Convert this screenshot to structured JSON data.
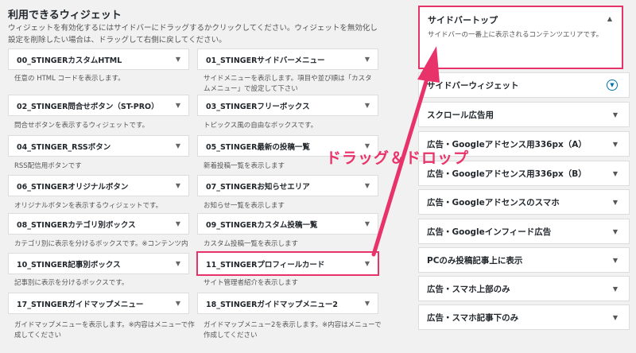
{
  "header": {
    "title": "利用できるウィジェット",
    "description": "ウィジェットを有効化するにはサイドバーにドラッグするかクリックしてください。ウィジェットを無効化し設定を削除したい場合は、ドラッグして右側に戻してください。"
  },
  "widgets": [
    {
      "title": "00_STINGERカスタムHTML",
      "desc": "任意の HTML コードを表示します。"
    },
    {
      "title": "01_STINGERサイドバーメニュー",
      "desc": "サイドメニューを表示します。項目や並び順は「カスタムメニュー」で設定して下さい"
    },
    {
      "title": "02_STINGER問合せボタン（ST-PRO）",
      "desc": "問合せボタンを表示するウィジェットです。"
    },
    {
      "title": "03_STINGERフリーボックス",
      "desc": "トピックス風の自由なボックスです。"
    },
    {
      "title": "04_STINGER_RSSボタン",
      "desc": "RSS配信用ボタンです"
    },
    {
      "title": "05_STINGER最新の投稿一覧",
      "desc": "新着投稿一覧を表示します"
    },
    {
      "title": "06_STINGERオリジナルボタン",
      "desc": "オリジナルボタンを表示するウィジェットです。"
    },
    {
      "title": "07_STINGERお知らせエリア",
      "desc": "お知らせ一覧を表示します"
    },
    {
      "title": "08_STINGERカテゴリ別ボックス",
      "desc": "カテゴリ別に表示を分けるボックスです。※コンテンツ内"
    },
    {
      "title": "09_STINGERカスタム投稿一覧",
      "desc": "カスタム投稿一覧を表示します"
    },
    {
      "title": "10_STINGER記事別ボックス",
      "desc": "記事別に表示を分けるボックスです。"
    },
    {
      "title": "11_STINGERプロフィールカード",
      "desc": "サイト管理者紹介を表示します"
    },
    {
      "title": "17_STINGERガイドマップメニュー",
      "desc": "ガイドマップメニューを表示します。※内容はメニューで作成してください"
    },
    {
      "title": "18_STINGERガイドマップメニュー2",
      "desc": "ガイドマップメニュー2を表示します。※内容はメニューで作成してください"
    }
  ],
  "sidebar_top": {
    "title": "サイドバートップ",
    "description": "サイドバーの一番上に表示されるコンテンツエリアです。"
  },
  "areas": [
    "サイドバーウィジェット",
    "スクロール広告用",
    "広告・Googleアドセンス用336px（A）",
    "広告・Googleアドセンス用336px（B）",
    "広告・Googleアドセンスのスマホ",
    "広告・Googleインフィード広告",
    "PCのみ投稿記事上に表示",
    "広告・スマホ上部のみ",
    "広告・スマホ記事下のみ"
  ],
  "annotation": {
    "label": "ドラッグ＆ドロップ",
    "color": "#e8336a"
  },
  "icons": {
    "collapse": "triangle-down-icon",
    "expand": "triangle-up-icon",
    "toggle": "circle-chevron-down-icon"
  }
}
